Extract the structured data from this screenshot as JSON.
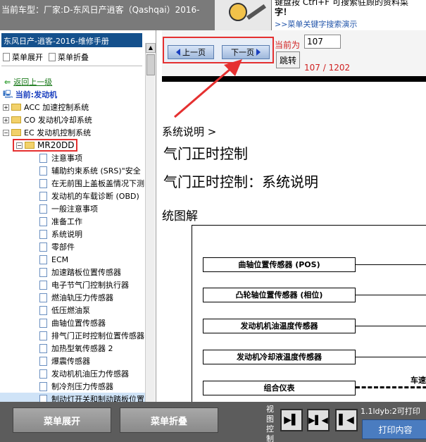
{
  "header": {
    "car_model": "当前车型：厂家:D-东风日产逍客（Qashqai）2016-",
    "hint_line1": "键盘按  Ctrl+F  可搜索驻顾的资料菜",
    "hint_line2": "字！",
    "hint_link": ">>菜单关键字搜索演示"
  },
  "sidebar": {
    "title": "东风日产-逍客-2016-维修手册",
    "expand_label": "菜单展开",
    "collapse_label": "菜单折叠",
    "back_label": "返回上一级",
    "current_label": "当前:发动机",
    "top_items": [
      {
        "label": "ACC 加速控制系统"
      },
      {
        "label": "CO 发动机冷却系统"
      },
      {
        "label": "EC 发动机控制系统"
      }
    ],
    "highlight_folder": "MR20DD",
    "items": [
      {
        "label": "注意事项"
      },
      {
        "label": "辅助约束系统 (SRS)\"安全"
      },
      {
        "label": "在无前围上盖板盖情况下测"
      },
      {
        "label": "发动机的车载诊断 (OBD)"
      },
      {
        "label": "一般注意事项"
      },
      {
        "label": "准备工作"
      },
      {
        "label": "系统说明"
      },
      {
        "label": "零部件"
      },
      {
        "label": "ECM"
      },
      {
        "label": "加速踏板位置传感器"
      },
      {
        "label": "电子节气门控制执行器"
      },
      {
        "label": "燃油轨压力传感器"
      },
      {
        "label": "低压燃油泵"
      },
      {
        "label": "曲轴位置传感器"
      },
      {
        "label": "排气门正时控制位置传感器"
      },
      {
        "label": "加热型氧传感器 2"
      },
      {
        "label": "爆震传感器"
      },
      {
        "label": "发动机机油压力传感器"
      },
      {
        "label": "制冷剂压力传感器"
      },
      {
        "label": "制动灯开关和制动踏板位置"
      }
    ]
  },
  "pager": {
    "prev_label": "上一页",
    "next_label": "下一页",
    "current_label": "当前为",
    "current_value": "107",
    "go_label": "跳转",
    "count": "107 / 1202"
  },
  "document": {
    "breadcrumb": "系统说明 >",
    "heading1": "气门正时控制",
    "heading2": "气门正时控制：系统说明",
    "heading3": "统图解",
    "sensors": [
      {
        "label": "曲轴位置传感器 (POS)"
      },
      {
        "label": "凸轮轴位置传感器 (相位)"
      },
      {
        "label": "发动机机油温度传感器"
      },
      {
        "label": "发动机冷却液温度传感器"
      },
      {
        "label": "组合仪表"
      }
    ],
    "speed_label": "车速"
  },
  "footer": {
    "expand_label": "菜单展开",
    "collapse_label": "菜单折叠",
    "view_label": "视图控制",
    "print_info": "1.1ldyb:2可打印",
    "print_label": "打印内容"
  },
  "colors": {
    "title_bg": "#14508c",
    "highlight": "#e53030",
    "page_red": "#d02020",
    "bottom_bg": "#5c5c5c"
  }
}
